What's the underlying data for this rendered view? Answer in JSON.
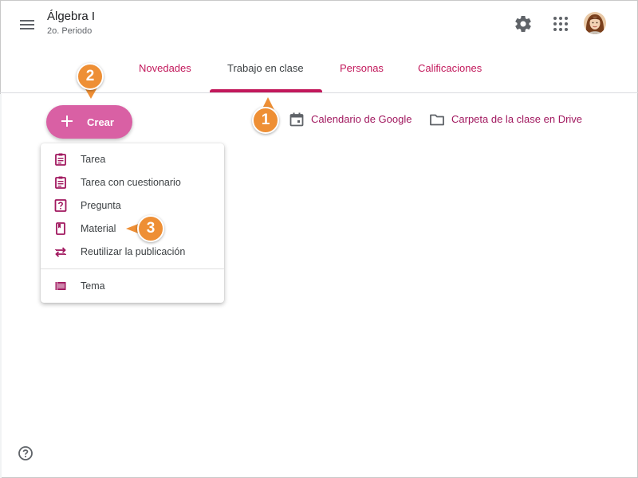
{
  "header": {
    "course_title": "Álgebra I",
    "course_subtitle": "2o. Periodo",
    "tabs": [
      {
        "label": "Novedades",
        "active": false
      },
      {
        "label": "Trabajo en clase",
        "active": true
      },
      {
        "label": "Personas",
        "active": false
      },
      {
        "label": "Calificaciones",
        "active": false
      }
    ],
    "icons": [
      "menu-icon",
      "gear-icon",
      "apps-icon",
      "avatar"
    ]
  },
  "toolbar": {
    "create_label": "Crear",
    "calendar_label": "Calendario de Google",
    "drive_label": "Carpeta de la clase en Drive"
  },
  "create_menu": {
    "items": [
      {
        "label": "Tarea",
        "icon": "assignment-icon"
      },
      {
        "label": "Tarea con cuestionario",
        "icon": "quiz-assignment-icon"
      },
      {
        "label": "Pregunta",
        "icon": "question-icon"
      },
      {
        "label": "Material",
        "icon": "material-icon"
      },
      {
        "label": "Reutilizar la publicación",
        "icon": "reuse-icon"
      },
      {
        "label": "Tema",
        "icon": "topic-icon"
      }
    ]
  },
  "callouts": [
    {
      "number": "1"
    },
    {
      "number": "2"
    },
    {
      "number": "3"
    }
  ],
  "colors": {
    "accent": "#c2185b",
    "create_button": "#d960a4",
    "link": "#a1185f",
    "callout": "#ee8f35"
  }
}
